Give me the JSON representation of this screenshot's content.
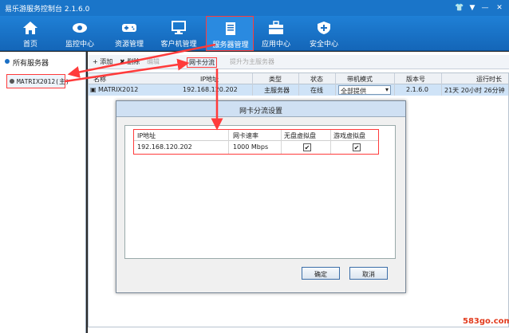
{
  "window": {
    "title": "易乐游服务控制台 2.1.6.0",
    "controls": [
      "👕",
      "▼",
      "—",
      "✕"
    ]
  },
  "nav": [
    {
      "label": "首页",
      "icon": "home-icon"
    },
    {
      "label": "监控中心",
      "icon": "eye-icon"
    },
    {
      "label": "资源管理",
      "icon": "gamepad-icon"
    },
    {
      "label": "客户机管理",
      "icon": "monitor-icon"
    },
    {
      "label": "服务器管理",
      "icon": "server-doc-icon"
    },
    {
      "label": "应用中心",
      "icon": "toolbox-icon"
    },
    {
      "label": "安全中心",
      "icon": "shield-icon"
    }
  ],
  "left": {
    "header": "所有服务器",
    "item": "MATRIX2012(主)"
  },
  "toolbar": {
    "add": "+ 添加",
    "delete": "✖ 删除",
    "edit": "编辑",
    "nic": "网卡分流",
    "promote": "提升为主服务器"
  },
  "grid": {
    "columns": [
      "名称",
      "IP地址",
      "类型",
      "状态",
      "带机模式",
      "版本号",
      "运行时长"
    ],
    "row": [
      "MATRIX2012",
      "192.168.120.202",
      "主服务器",
      "在线",
      "全部提供",
      "2.1.6.0",
      "21天 20小时 26分钟"
    ]
  },
  "dialog": {
    "title": "网卡分流设置",
    "columns": [
      "IP地址",
      "网卡速率",
      "无盘虚拟盘",
      "游戏虚拟盘"
    ],
    "row": {
      "ip": "192.168.120.202",
      "rate": "1000 Mbps",
      "diskless": "✔",
      "game": "✔"
    },
    "ok": "确定",
    "cancel": "取消"
  },
  "watermark": "583go.com",
  "colors": {
    "accent": "#1a75c9",
    "annotation": "#ff3b3b"
  }
}
